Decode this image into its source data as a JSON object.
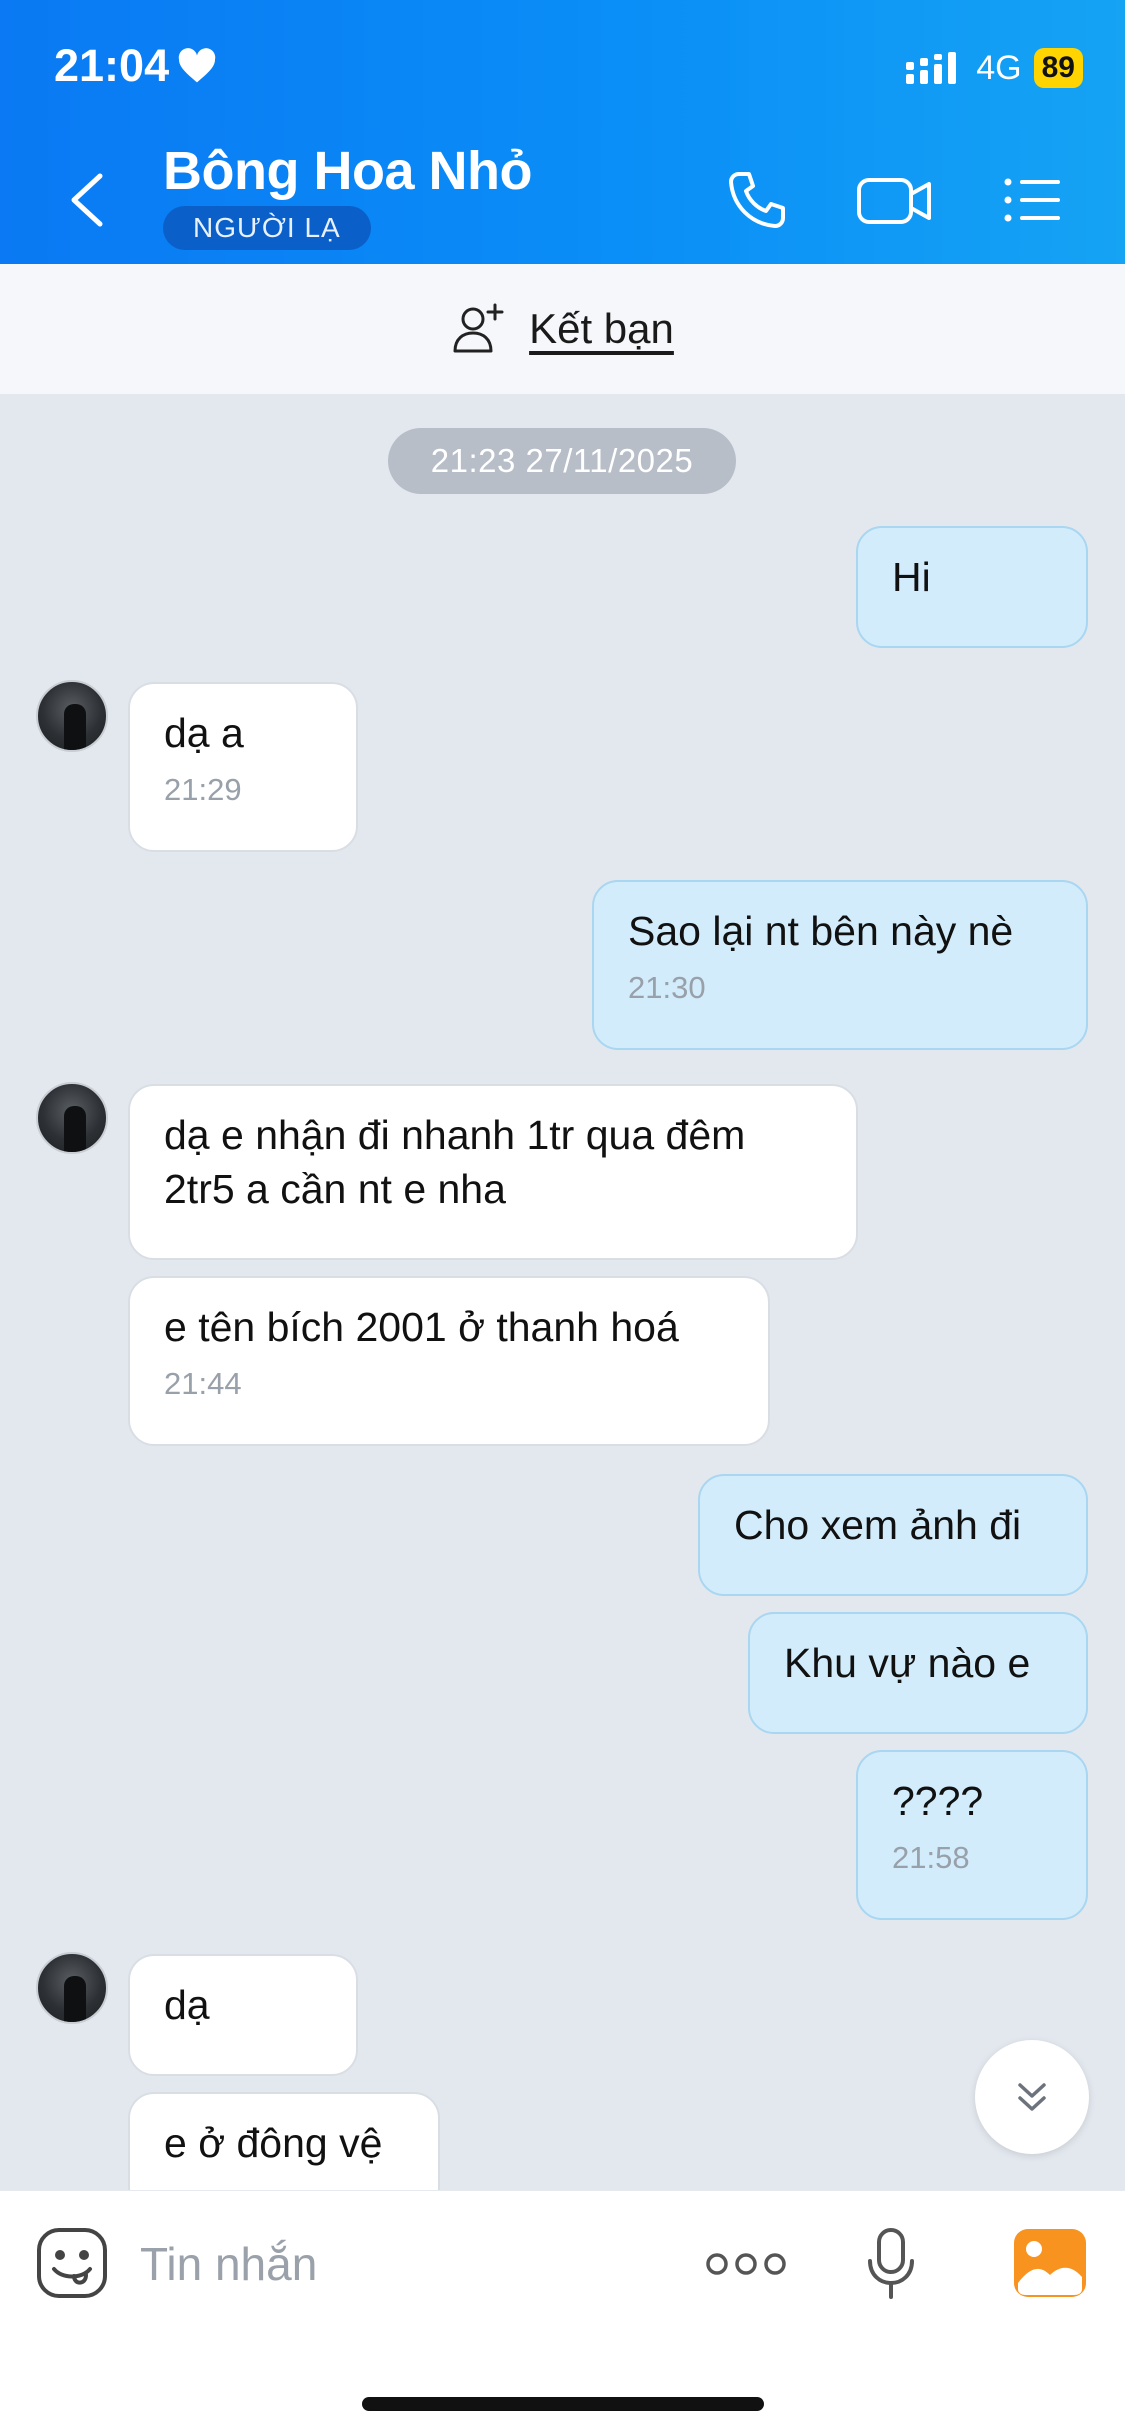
{
  "status": {
    "time": "21:04",
    "network": "4G",
    "battery": "89"
  },
  "header": {
    "title": "Bông Hoa Nhỏ",
    "badge": "NGƯỜI LẠ"
  },
  "add_friend": {
    "label": "Kết bạn"
  },
  "chat": {
    "date": "21:23 27/11/2025",
    "messages": [
      {
        "text": "Hi"
      },
      {
        "text": "dạ a",
        "time": "21:29"
      },
      {
        "text": "Sao lại nt bên này nè",
        "time": "21:30"
      },
      {
        "text": "dạ e nhận đi nhanh 1tr qua đêm 2tr5 a cần nt e nha"
      },
      {
        "text": "e tên bích 2001 ở thanh hoá",
        "time": "21:44"
      },
      {
        "text": "Cho xem ảnh đi"
      },
      {
        "text": "Khu vự nào e"
      },
      {
        "text": "????",
        "time": "21:58"
      },
      {
        "text": "dạ"
      },
      {
        "text": "e ở đông vệ"
      }
    ]
  },
  "input": {
    "placeholder": "Tin nhắn"
  },
  "colors": {
    "header_start": "#0a79f3",
    "header_end": "#15a3f4",
    "my_bubble": "#d2ecfb",
    "their_bubble": "#ffffff",
    "chat_bg": "#e3e8ef"
  }
}
